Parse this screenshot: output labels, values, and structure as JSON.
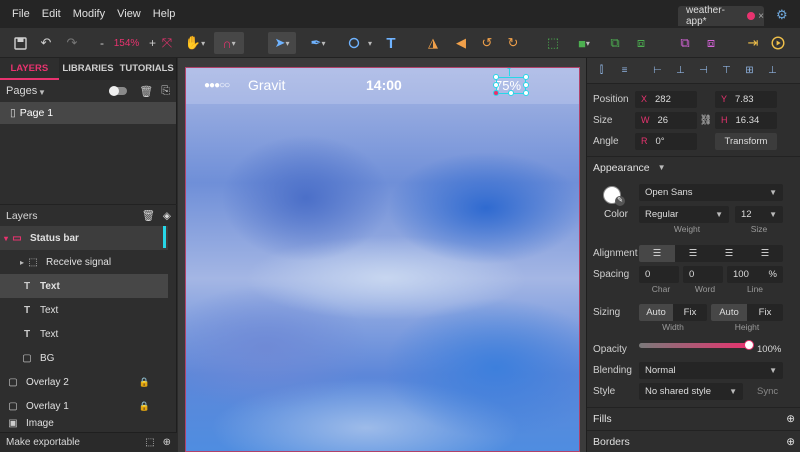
{
  "menu": [
    "File",
    "Edit",
    "Modify",
    "View",
    "Help"
  ],
  "document_tab": {
    "name": "weather-app*",
    "close": "×"
  },
  "toolbar": {
    "zoom": {
      "value": "154%",
      "minus": "-",
      "plus": "+"
    },
    "icons": [
      "save-icon",
      "undo-icon",
      "redo-icon",
      "fit-icon",
      "hand-icon",
      "magnet-icon",
      "pointer-icon",
      "pen-icon",
      "ellipse-icon",
      "text-icon",
      "flip-horizontal-icon",
      "flip-vertical-icon",
      "rotate-left-icon",
      "rotate-right-icon",
      "group-icon",
      "boolean-icon",
      "union-icon",
      "subtract-icon",
      "symbol-icon",
      "detach-icon",
      "export-icon",
      "play-icon"
    ]
  },
  "left_panel": {
    "tabs": [
      "LAYERS",
      "LIBRARIES",
      "TUTORIALS"
    ],
    "active_tab": "LAYERS",
    "pages_title": "Pages",
    "page": "Page 1",
    "layers_title": "Layers",
    "layers": [
      {
        "label": "Status bar",
        "kind": "group",
        "expanded": true
      },
      {
        "label": "Receive signal",
        "kind": "group-child"
      },
      {
        "label": "Text",
        "kind": "text",
        "selected": true
      },
      {
        "label": "Text",
        "kind": "text"
      },
      {
        "label": "Text",
        "kind": "text"
      },
      {
        "label": "BG",
        "kind": "rect"
      },
      {
        "label": "Overlay 2",
        "kind": "rect",
        "locked": true
      },
      {
        "label": "Overlay 1",
        "kind": "rect",
        "locked": true
      },
      {
        "label": "Image",
        "kind": "rect"
      }
    ],
    "bottom": {
      "label": "Make exportable"
    }
  },
  "canvas": {
    "status_bar": {
      "signal": "●●●○○",
      "carrier": "Gravit",
      "time": "14:00",
      "battery": "75%"
    },
    "accent": "#e8336f",
    "selection_color": "#27d7e8"
  },
  "right_panel": {
    "position": {
      "label": "Position",
      "x_key": "X",
      "x": "282",
      "y_key": "Y",
      "y": "7.83"
    },
    "size": {
      "label": "Size",
      "w_key": "W",
      "w": "26",
      "h_key": "H",
      "h": "16.34"
    },
    "angle": {
      "label": "Angle",
      "r_key": "R",
      "r": "0°",
      "transform": "Transform"
    },
    "appearance": {
      "title": "Appearance",
      "font": "Open Sans",
      "color_label": "Color",
      "weight": "Regular",
      "weight_label": "Weight",
      "size": "12",
      "size_label": "Size",
      "alignment_label": "Alignment",
      "spacing_label": "Spacing",
      "char": "0",
      "char_label": "Char",
      "word": "0",
      "word_label": "Word",
      "line": "100",
      "line_unit": "%",
      "line_label": "Line",
      "sizing_label": "Sizing",
      "width_auto": "Auto",
      "width_fix": "Fix",
      "width_label": "Width",
      "height_auto": "Auto",
      "height_fix": "Fix",
      "height_label": "Height",
      "opacity_label": "Opacity",
      "opacity": "100%",
      "opacity_fraction": 1.0,
      "blending_label": "Blending",
      "blending": "Normal",
      "style_label": "Style",
      "style": "No shared style",
      "sync": "Sync"
    },
    "fills": "Fills",
    "borders": "Borders"
  }
}
